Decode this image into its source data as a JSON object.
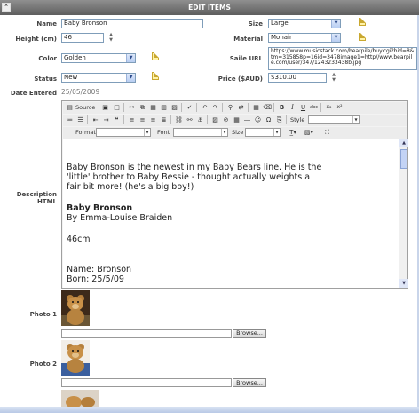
{
  "header": {
    "title": "EDIT ITEMS",
    "collapse_glyph": "⌃"
  },
  "form": {
    "name": {
      "label": "Name",
      "value": "Baby Bronson"
    },
    "size": {
      "label": "Size",
      "value": "Large"
    },
    "height": {
      "label": "Height (cm)",
      "value": "46"
    },
    "material": {
      "label": "Material",
      "value": "Mohair"
    },
    "color": {
      "label": "Color",
      "value": "Golden"
    },
    "saile_url": {
      "label": "Saile URL",
      "value": "https://www.musicstack.com/bearpile/buy.cgi?bid=8&tm=315858p=16id=3478image1=http//www.bearpile.com/user/347/1243233438b.jpg"
    },
    "status": {
      "label": "Status",
      "value": "New"
    },
    "price": {
      "label": "Price ($AUD)",
      "value": "$310.00"
    },
    "date_entered": {
      "label": "Date Entered",
      "value": "25/05/2009"
    },
    "description": {
      "label": "Description HTML"
    },
    "photo1": {
      "label": "Photo 1",
      "browse_label": "Browse..."
    },
    "photo2": {
      "label": "Photo 2",
      "browse_label": "Browse..."
    }
  },
  "editor": {
    "source_label": "Source",
    "style_label": "Style",
    "format_label": "Format",
    "font_label": "Font",
    "size_label": "Size",
    "content": {
      "para1_line1": "Baby Bronson is the newest in my Baby Bears line. He is the",
      "para1_line2": "'little' brother to Baby Bessie - thought actually weights a",
      "para1_line3": "fair bit more! (he's a big boy!)",
      "heading": "Baby Bronson",
      "byline": "By Emma-Louise Braiden",
      "height_text": "46cm",
      "name_line": "Name: Bronson",
      "born_line": "Born: 25/5/09"
    }
  },
  "colors": {
    "accent": "#6b6b6b",
    "field_border": "#7f9db9"
  }
}
